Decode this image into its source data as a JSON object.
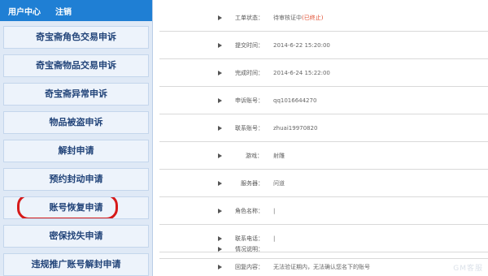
{
  "header": {
    "user_center": "用户中心",
    "logout": "注销"
  },
  "sidebar": {
    "items": [
      {
        "label": "奇宝斋角色交易申诉"
      },
      {
        "label": "奇宝斋物品交易申诉"
      },
      {
        "label": "奇宝斋异常申诉"
      },
      {
        "label": "物品被盗申诉"
      },
      {
        "label": "解封申请"
      },
      {
        "label": "预约封动申请"
      },
      {
        "label": "账号恢复申请"
      },
      {
        "label": "密保找失申请"
      },
      {
        "label": "违规推广账号解封申请"
      }
    ]
  },
  "details": {
    "status": {
      "label": "工单状态：",
      "value": "待审核证中",
      "highlight": "(已终止)"
    },
    "submit": {
      "label": "提交时间：",
      "value": "2014-6-22 15:20:00"
    },
    "complete": {
      "label": "完成时间：",
      "value": "2014-6-24 15:22:00"
    },
    "appeal": {
      "label": "申诉账号：",
      "value": "qq1016644270"
    },
    "contact": {
      "label": "联系账号：",
      "value": "zhuai19970820"
    },
    "server": {
      "label": "游戏：",
      "value": "射雕"
    },
    "region": {
      "label": "服务器：",
      "value": "问道"
    },
    "role": {
      "label": "角色名称：",
      "value": "|"
    },
    "phone": {
      "label": "联系电话：",
      "value": "|"
    },
    "desc": {
      "label": "情况说明：",
      "value": ""
    },
    "reply": {
      "label": "回复内容：",
      "value": "无法验证期内，无法确认您名下的账号"
    }
  },
  "watermark": "GM客服"
}
